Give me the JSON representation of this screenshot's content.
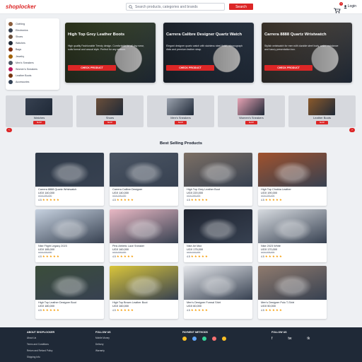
{
  "header": {
    "logo": "shoplocker",
    "search_placeholder": "Search products, categories and brands",
    "search_button": "Search",
    "cart_count": "1",
    "login_label": "Login"
  },
  "sidebar": {
    "items": [
      {
        "label": "Clothing",
        "color": "#8b5e3c"
      },
      {
        "label": "Electronics",
        "color": "#374151"
      },
      {
        "label": "Shoes",
        "color": "#6b4f3a"
      },
      {
        "label": "Watches",
        "color": "#1f2937"
      },
      {
        "label": "Bags",
        "color": "#7c2d12"
      },
      {
        "label": "Jewelry",
        "color": "#a16207"
      },
      {
        "label": "Men's Sneakers",
        "color": "#4b5563"
      },
      {
        "label": "Women's Sneakers",
        "color": "#be185d"
      },
      {
        "label": "Leather Boots",
        "color": "#78350f"
      },
      {
        "label": "Accessories",
        "color": "#334155"
      }
    ]
  },
  "hero": [
    {
      "title": "High Top Grey Leather Boots",
      "desc": "High quality Fashionable Trendy design. Comfortable for all day wear, suits formal and casual style. Perfect for any season.",
      "button": "CHECK PRODUCT",
      "bg": "#5b6b3a"
    },
    {
      "title": "Carrera Calibre Designer Quartz Watch",
      "desc": "Elegant designer quartz watch with stainless steel finish, chronograph dials and premium leather strap.",
      "button": "CHECK PRODUCT",
      "bg": "#3d4b5c"
    },
    {
      "title": "Carrera 8888 Quartz Wristwatch",
      "desc": "Stylish wristwatch for men with durable steel body, water resistance and luxury presentation box.",
      "button": "CHECK PRODUCT",
      "bg": "#7a6a58"
    }
  ],
  "categories": [
    {
      "name": "Watches",
      "button": "SHOP",
      "color": "#374151"
    },
    {
      "name": "Shoes",
      "button": "SHOP",
      "color": "#6b4f3a"
    },
    {
      "name": "Men's Sneakers",
      "button": "SHOP",
      "color": "#9ca3af"
    },
    {
      "name": "Women's Sneakers",
      "button": "SHOP",
      "color": "#e7a3b4"
    },
    {
      "name": "Leather Boots",
      "button": "SHOP",
      "color": "#8b5a2b"
    }
  ],
  "section_title": "Best Selling Products",
  "products": [
    {
      "name": "Carrera 8888 Quartz Wristwatch",
      "price": "UGX 140,000",
      "old": "UGX 180,000",
      "rating": "4.5",
      "color": "#2f3a48"
    },
    {
      "name": "Carrera Calibre Designer",
      "price": "UGX 140,000",
      "old": "UGX 180,000",
      "rating": "4.5",
      "color": "#4b5563"
    },
    {
      "name": "High Top Grey Leather Boot",
      "price": "UGX 220,000",
      "old": "UGX 260,000",
      "rating": "4.5",
      "color": "#7c6f64"
    },
    {
      "name": "High Top Chukka Leather",
      "price": "UGX 190,000",
      "old": "UGX 230,000",
      "rating": "4.5",
      "color": "#a0522d"
    },
    {
      "name": "Nike Flight Legacy 2023",
      "price": "UGX 185,000",
      "old": "UGX 220,000",
      "rating": "4.5",
      "color": "#c7d2e0"
    },
    {
      "name": "Pink Athletic Lace Sneaker",
      "price": "UGX 160,000",
      "old": "UGX 200,000",
      "rating": "4.5",
      "color": "#e9b8c4"
    },
    {
      "name": "Nike Air Max",
      "price": "UGX 175,000",
      "old": "UGX 210,000",
      "rating": "4.5",
      "color": "#1f2430"
    },
    {
      "name": "Nike 2023 White",
      "price": "UGX 170,000",
      "old": "UGX 205,000",
      "rating": "4.5",
      "color": "#d7dbe0"
    },
    {
      "name": "High Top Leather Designer Boot",
      "price": "UGX 180,000",
      "old": "",
      "rating": "4.5",
      "color": "#3b4d3a"
    },
    {
      "name": "High Top Brown Leather Boot",
      "price": "UGX 160,000",
      "old": "",
      "rating": "4.5",
      "color": "#d9c53a"
    },
    {
      "name": "Men's Designer Formal Shirt",
      "price": "UGX 60,000",
      "old": "",
      "rating": "4.5",
      "color": "#e5e7eb"
    },
    {
      "name": "Men's Designer Polo T-Shirt",
      "price": "UGX 50,000",
      "old": "",
      "rating": "4.5",
      "color": "#8f7a6d"
    }
  ],
  "footer": {
    "col1_title": "ABOUT SHOPLOCKER",
    "col1_links": [
      "About Us",
      "Terms and Conditions",
      "Return and Refund Policy",
      "Shipping Info"
    ],
    "col2_title": "FOLLOW US",
    "col2_links": [
      "Mobile Money",
      "Delivery",
      "Warranty"
    ],
    "col3_title": "PAYMENT METHODS",
    "col4_title": "FOLLOW US",
    "social": [
      "f",
      "tw",
      "tk"
    ],
    "pay_colors": [
      "#fbbf24",
      "#60a5fa",
      "#34d399",
      "#f87171",
      "#fbbf24"
    ]
  }
}
